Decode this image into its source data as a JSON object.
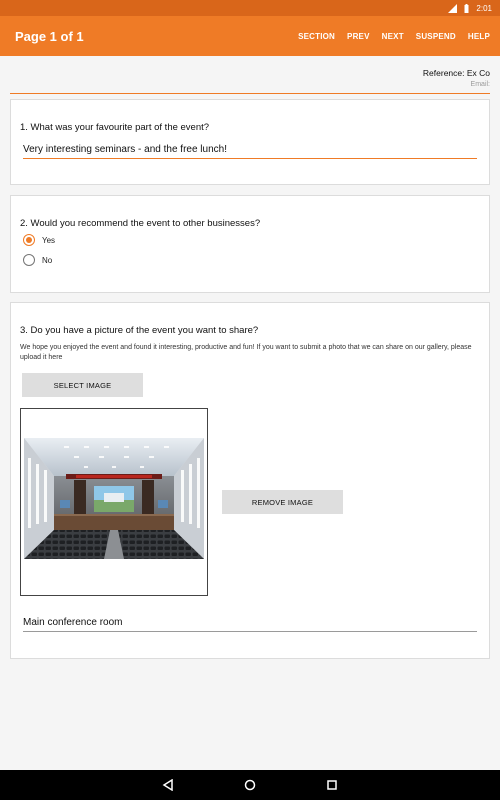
{
  "status_bar": {
    "time": "2:01"
  },
  "app_bar": {
    "title": "Page 1 of 1",
    "actions": [
      "SECTION",
      "PREV",
      "NEXT",
      "SUSPEND",
      "HELP"
    ]
  },
  "header": {
    "reference": "Reference: Ex Co",
    "email": "Email:"
  },
  "questions": [
    {
      "title": "1. What was your favourite part of the event?",
      "answer": "Very interesting seminars - and the free lunch!"
    },
    {
      "title": "2. Would you recommend the event to other businesses?",
      "options": [
        {
          "label": "Yes",
          "selected": true
        },
        {
          "label": "No",
          "selected": false
        }
      ]
    },
    {
      "title": "3. Do you have a picture of the event you want to share?",
      "description": "We hope you enjoyed the event and found it interesting, productive and fun! If you want to submit a photo that we can share on our gallery, please upload it here",
      "select_label": "SELECT IMAGE",
      "remove_label": "REMOVE IMAGE",
      "caption": "Main conference room"
    }
  ],
  "colors": {
    "accent": "#ef7b26",
    "status_bar": "#d9661a"
  }
}
